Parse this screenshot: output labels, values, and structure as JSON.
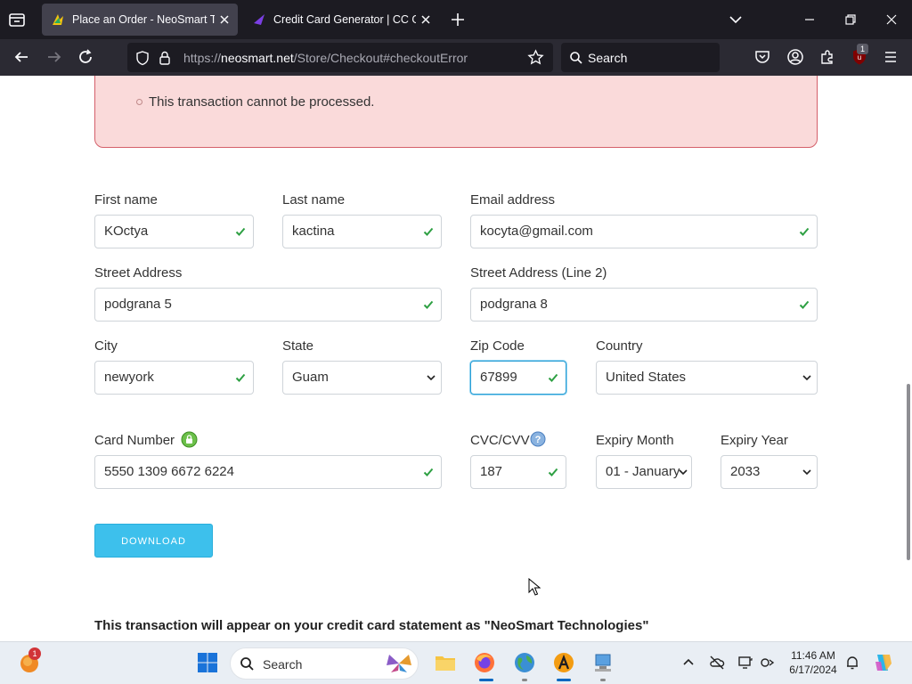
{
  "browser": {
    "tabs": [
      {
        "title": "Place an Order - NeoSmart Technologies",
        "active": true
      },
      {
        "title": "Credit Card Generator | CC Generator",
        "active": false
      }
    ],
    "url_prefix": "https://",
    "url_host": "neosmart.net",
    "url_path": "/Store/Checkout#checkoutError",
    "search_placeholder": "Search",
    "extension_badge": "1"
  },
  "error": {
    "message": "This transaction cannot be processed."
  },
  "form": {
    "first_name_label": "First name",
    "first_name_value": "KOctya",
    "last_name_label": "Last name",
    "last_name_value": "kactina",
    "email_label": "Email address",
    "email_value": "kocyta@gmail.com",
    "street_label": "Street Address",
    "street_value": "podgrana 5",
    "street2_label": "Street Address (Line 2)",
    "street2_value": "podgrana 8",
    "city_label": "City",
    "city_value": "newyork",
    "state_label": "State",
    "state_value": "Guam",
    "zip_label": "Zip Code",
    "zip_value": "67899",
    "country_label": "Country",
    "country_value": "United States",
    "card_label": "Card Number",
    "card_value": "5550 1309 6672 6224",
    "cvc_label": "CVC/CVV",
    "cvc_value": "187",
    "month_label": "Expiry Month",
    "month_value": "01 - January",
    "year_label": "Expiry Year",
    "year_value": "2033",
    "download_label": "DOWNLOAD",
    "statement_text": "This transaction will appear on your credit card statement as \"NeoSmart Technologies\""
  },
  "taskbar": {
    "search_label": "Search",
    "notification_badge": "1",
    "time": "11:46 AM",
    "date": "6/17/2024"
  },
  "colors": {
    "accent": "#3dc0ec",
    "error_bg": "#fadada",
    "valid": "#2ea043"
  }
}
